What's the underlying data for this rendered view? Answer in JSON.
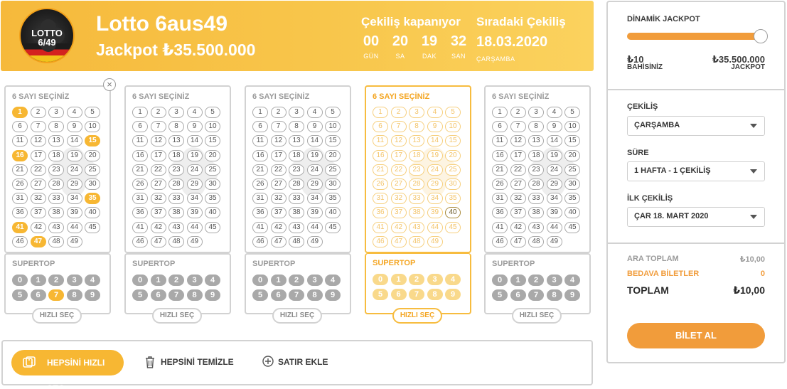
{
  "header": {
    "logo_line1": "LOTTO",
    "logo_line2": "6/49",
    "title": "Lotto 6aus49",
    "jackpot": "Jackpot ₺35.500.000",
    "countdown_title": "Çekiliş kapanıyor",
    "countdown": [
      {
        "value": "00",
        "unit": "GÜN"
      },
      {
        "value": "20",
        "unit": "SA"
      },
      {
        "value": "19",
        "unit": "DAK"
      },
      {
        "value": "32",
        "unit": "SAN"
      }
    ],
    "next_title": "Sıradaki Çekiliş",
    "next_date": "18.03.2020",
    "next_day": "ÇARŞAMBA"
  },
  "tickets": [
    {
      "title": "6 SAYI SEÇİNİZ",
      "selected": [
        1,
        15,
        16,
        35,
        41,
        47
      ],
      "highlighted": [],
      "super_title": "SUPERTOP",
      "super_selected": [
        7
      ],
      "quick": "HIZLI SEÇ",
      "active": false,
      "closable": true
    },
    {
      "title": "6 SAYI SEÇİNİZ",
      "selected": [],
      "highlighted": [],
      "super_title": "SUPERTOP",
      "super_selected": [],
      "quick": "HIZLI SEÇ",
      "active": false,
      "closable": false
    },
    {
      "title": "6 SAYI SEÇİNİZ",
      "selected": [],
      "highlighted": [],
      "super_title": "SUPERTOP",
      "super_selected": [],
      "quick": "HIZLI SEÇ",
      "active": false,
      "closable": false
    },
    {
      "title": "6 SAYI SEÇİNİZ",
      "selected": [],
      "highlighted": [
        40
      ],
      "super_title": "SUPERTOP",
      "super_selected": [],
      "quick": "HIZLI SEÇ",
      "active": true,
      "closable": false
    },
    {
      "title": "6 SAYI SEÇİNİZ",
      "selected": [],
      "highlighted": [],
      "super_title": "SUPERTOP",
      "super_selected": [],
      "quick": "HIZLI SEÇ",
      "active": false,
      "closable": false
    }
  ],
  "close_icon": "×",
  "actions": {
    "quick_all": "HEPSİNİ HIZLI SEÇ",
    "clear_all": "HEPSİNİ TEMİZLE",
    "add_row": "SATIR EKLE"
  },
  "sidebar": {
    "jackpot_label": "DİNAMİK JACKPOT",
    "slider_level": 1.0,
    "min_value": "₺10",
    "min_label": "BAHİSİNİZ",
    "max_value": "₺35.500.000",
    "max_label": "JACKPOT",
    "draw_label": "ÇEKİLİŞ",
    "draw_value": "ÇARŞAMBA",
    "duration_label": "SÜRE",
    "duration_value": "1 HAFTA - 1 ÇEKİLİŞ",
    "first_draw_label": "İLK ÇEKİLİŞ",
    "first_draw_value": "ÇAR 18. MART 2020",
    "subtotal_label": "ARA TOPLAM",
    "subtotal_value": "₺10,00",
    "free_label": "BEDAVA BİLETLER",
    "free_value": "0",
    "total_label": "TOPLAM",
    "total_value": "₺10,00",
    "buy_label": "BİLET AL"
  },
  "colors": {
    "accent": "#f7b733",
    "button_orange": "#f19c3b",
    "border": "#d2d2d2"
  }
}
